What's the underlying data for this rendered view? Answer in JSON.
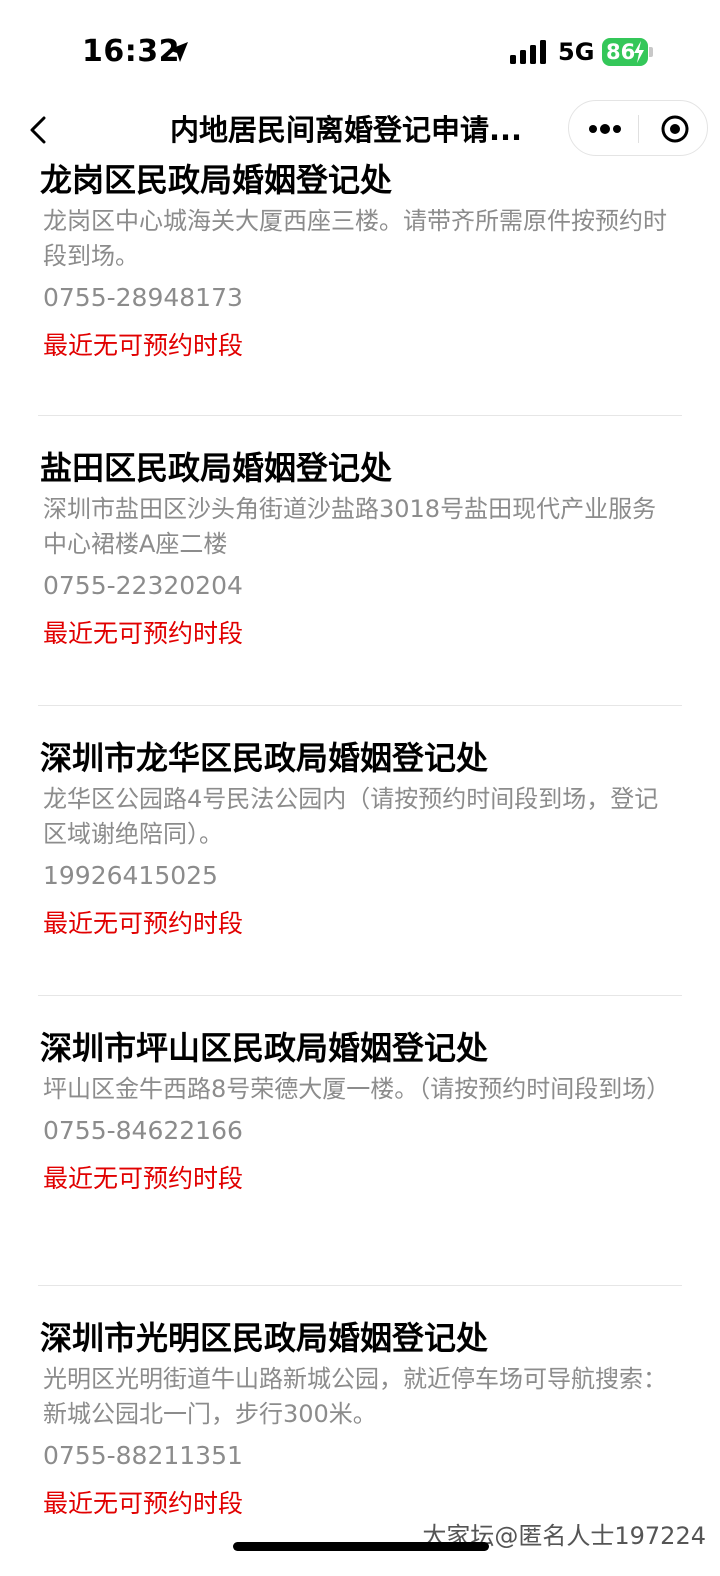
{
  "status_bar": {
    "time": "16:32",
    "network": "5G",
    "battery": "86"
  },
  "nav": {
    "title": "内地居民间离婚登记申请..."
  },
  "offices": [
    {
      "name": "龙岗区民政局婚姻登记处",
      "address": "龙岗区中心城海关大厦西座三楼。请带齐所需原件按预约时段到场。",
      "phone": "0755-28948173",
      "status": "最近无可预约时段"
    },
    {
      "name": "盐田区民政局婚姻登记处",
      "address": "深圳市盐田区沙头角街道沙盐路3018号盐田现代产业服务中心裙楼A座二楼",
      "phone": "0755-22320204",
      "status": "最近无可预约时段"
    },
    {
      "name": "深圳市龙华区民政局婚姻登记处",
      "address": "龙华区公园路4号民法公园内（请按预约时间段到场，登记区域谢绝陪同）。",
      "phone": "19926415025",
      "status": "最近无可预约时段"
    },
    {
      "name": "深圳市坪山区民政局婚姻登记处",
      "address": "坪山区金牛西路8号荣德大厦一楼。（请按预约时间段到场）",
      "phone": "0755-84622166",
      "status": "最近无可预约时段"
    },
    {
      "name": "深圳市光明区民政局婚姻登记处",
      "address": "光明区光明街道牛山路新城公园，就近停车场可导航搜索：新城公园北一门，步行300米。",
      "phone": "0755-88211351",
      "status": "最近无可预约时段"
    }
  ],
  "watermark": "大家坛@匿名人士197224",
  "colors": {
    "status_red": "#e10000",
    "secondary_gray": "#8c8c8c",
    "battery_green": "#34c759"
  },
  "icons": [
    "location-arrow-icon",
    "signal-icon",
    "battery-icon",
    "back-chevron-icon",
    "more-dots-icon",
    "close-target-icon"
  ]
}
